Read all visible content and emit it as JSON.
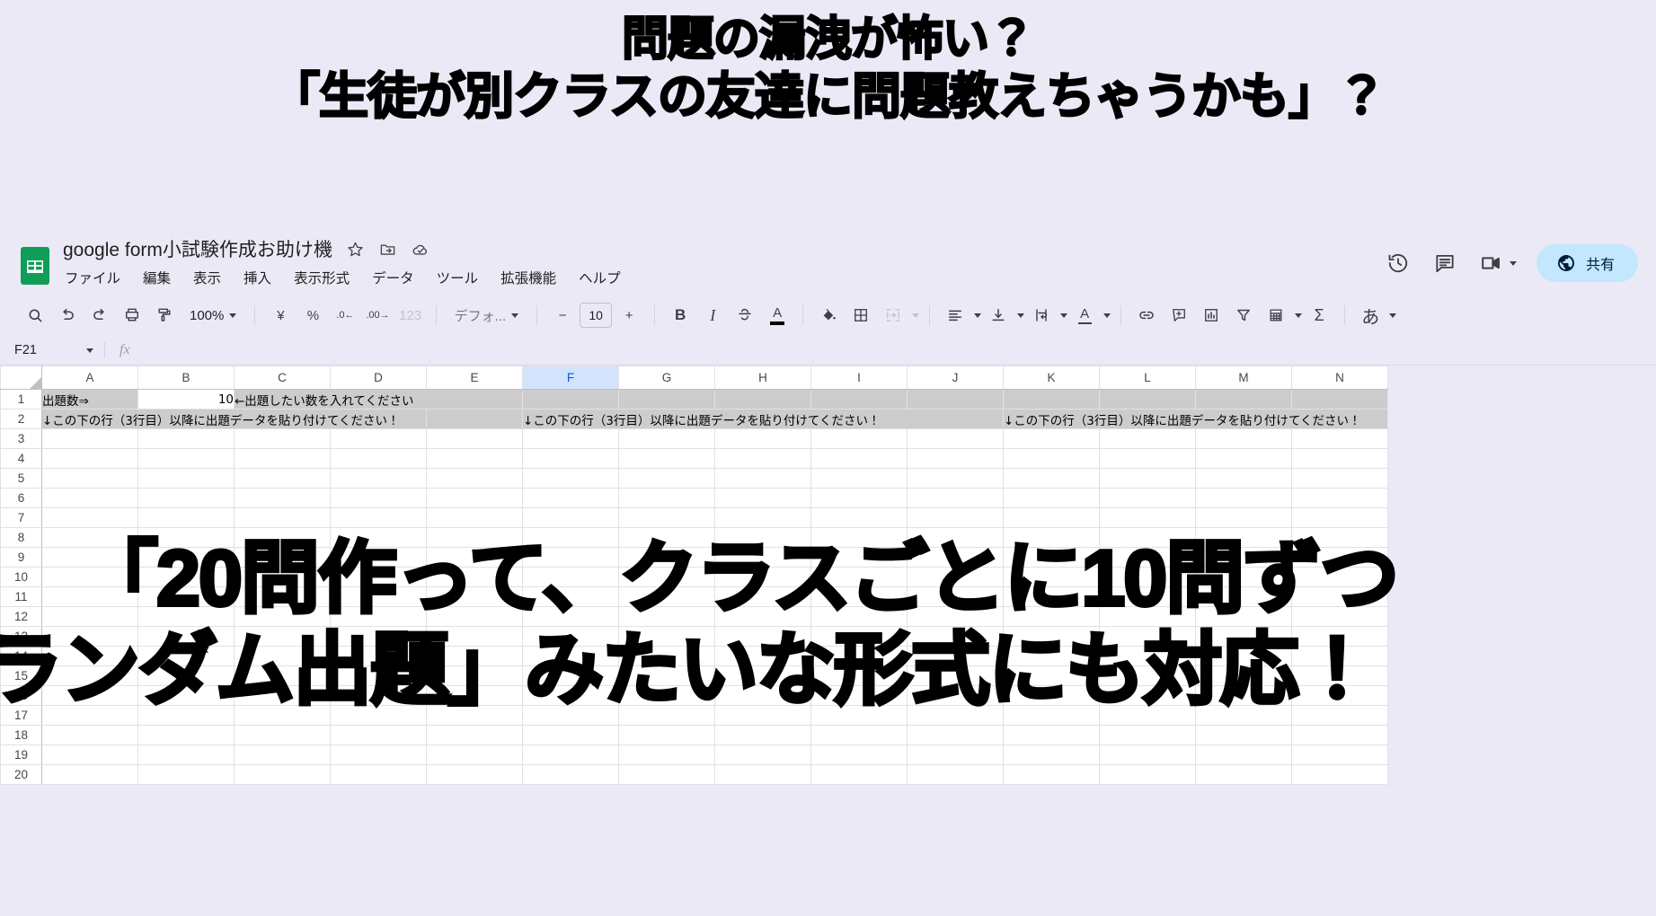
{
  "headline": {
    "line1": "問題の漏洩が怖い？",
    "line2": "「生徒が別クラスの友達に問題教えちゃうかも」？"
  },
  "overlay": {
    "line1": "「20問作って、クラスごとに10問ずつ",
    "line2": "ランダム出題」みたいな形式にも対応！"
  },
  "app": {
    "doc_title": "google form小試験作成お助け機",
    "title_icons": [
      "star-icon",
      "move-to-folder-icon",
      "cloud-saved-icon"
    ],
    "menus": [
      "ファイル",
      "編集",
      "表示",
      "挿入",
      "表示形式",
      "データ",
      "ツール",
      "拡張機能",
      "ヘルプ"
    ],
    "actions": {
      "history_icon": "version-history-icon",
      "comment_icon": "comment-icon",
      "meet_icon": "meet-camera-icon",
      "share_label": "共有",
      "share_icon": "globe-icon",
      "share_bg": "#c2e7ff"
    }
  },
  "toolbar": {
    "search_icon": "search-icon",
    "undo_icon": "undo-icon",
    "redo_icon": "redo-icon",
    "print_icon": "print-icon",
    "paint_icon": "paint-format-icon",
    "zoom_value": "100%",
    "currency_label": "¥",
    "percent_label": "%",
    "dec_decrease_label": ".0",
    "dec_increase_label": ".00",
    "number_format_label": "123",
    "font_value": "デフォ...",
    "font_size_value": "10",
    "minus_label": "−",
    "plus_label": "+",
    "bold_label": "B",
    "italic_label": "I",
    "strikethrough_icon": "strikethrough-icon",
    "text_color_label": "A",
    "fill_icon": "fill-color-icon",
    "borders_icon": "borders-icon",
    "merge_icon": "merge-cells-icon",
    "halign_icon": "horizontal-align-icon",
    "valign_icon": "vertical-align-icon",
    "wrap_icon": "text-wrap-icon",
    "rotate_icon": "text-rotation-icon",
    "link_icon": "insert-link-icon",
    "comment_icon": "insert-comment-icon",
    "chart_icon": "insert-chart-icon",
    "filter_icon": "filter-icon",
    "functions_icon": "pivot-table-icon",
    "sum_label": "Σ",
    "ime_label": "あ"
  },
  "formula_bar": {
    "name_box": "F21",
    "fx_label": "fx",
    "formula_value": "",
    "formula_placeholder": ""
  },
  "grid": {
    "columns": [
      "A",
      "B",
      "C",
      "D",
      "E",
      "F",
      "G",
      "H",
      "I",
      "J",
      "K",
      "L",
      "M",
      "N"
    ],
    "selected_column": "F",
    "rows": [
      "1",
      "2",
      "3",
      "4",
      "5",
      "6",
      "7",
      "8",
      "9",
      "10",
      "11",
      "12",
      "13",
      "14",
      "15",
      "16",
      "17",
      "18",
      "19",
      "20"
    ],
    "cells": {
      "A1": "出題数⇒",
      "B1": "10",
      "C1": "←出題したい数を入れてください",
      "A2": "↓この下の行（3行目）以降に出題データを貼り付けてください！",
      "F2": "↓この下の行（3行目）以降に出題データを貼り付けてください！",
      "K2": "↓この下の行（3行目）以降に出題データを貼り付けてください！"
    }
  }
}
